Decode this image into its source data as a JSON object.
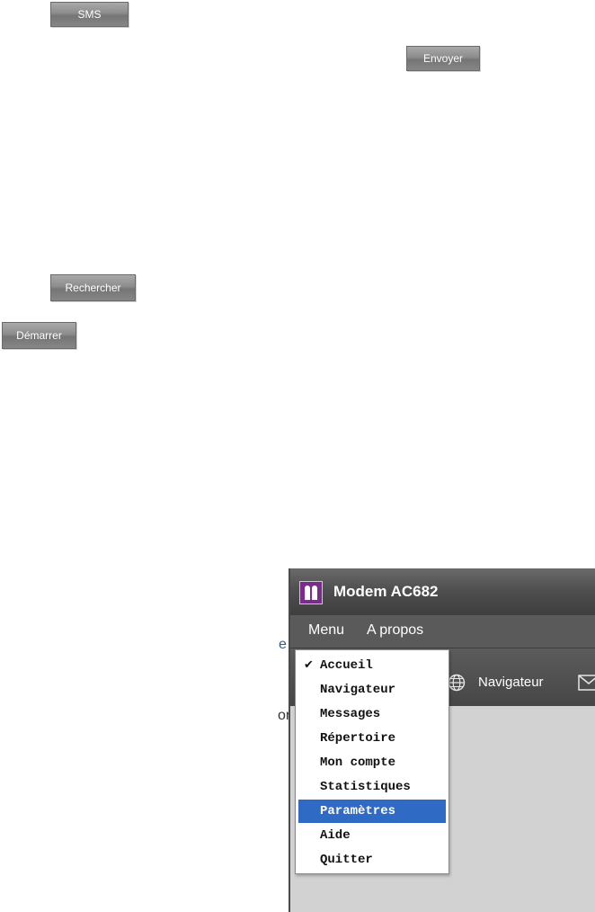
{
  "buttons": {
    "sms": "SMS",
    "envoyer": "Envoyer",
    "rechercher": "Rechercher",
    "demarrer": "Démarrer"
  },
  "app": {
    "title": "Modem AC682",
    "logo_icon": "modem-logo-icon",
    "menubar": {
      "menu": "Menu",
      "apropos": "A propos"
    },
    "toolbar": {
      "navigateur": "Navigateur"
    },
    "colors": {
      "logo": "#7b2a8e",
      "titlebar": "#4d4d4d",
      "menubar": "#5a5a5a",
      "content": "#d2d2d2",
      "selection": "#2f6bc5"
    }
  },
  "fragments": {
    "frag1": "e",
    "frag2": "or"
  },
  "dropdown": {
    "items": [
      {
        "label": "Accueil",
        "checked": true
      },
      {
        "label": "Navigateur"
      },
      {
        "label": "Messages"
      },
      {
        "label": "Répertoire"
      },
      {
        "label": "Mon compte"
      },
      {
        "label": "Statistiques"
      },
      {
        "label": "Paramètres",
        "selected": true
      },
      {
        "label": "Aide"
      },
      {
        "label": "Quitter"
      }
    ]
  }
}
